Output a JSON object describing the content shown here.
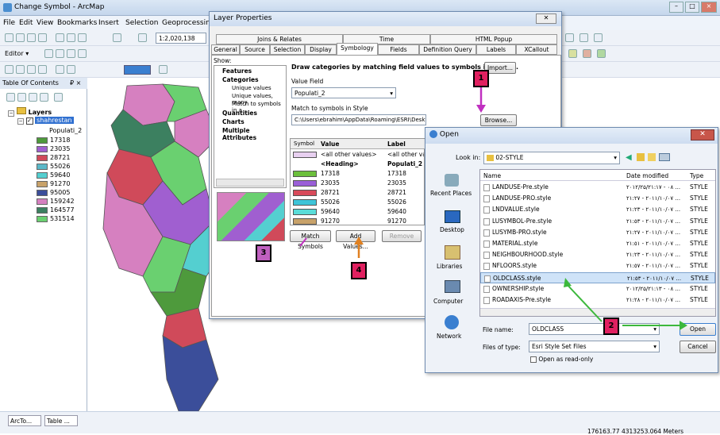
{
  "window": {
    "title": "Change Symbol - ArcMap",
    "controls": [
      "–",
      "□",
      "×"
    ]
  },
  "menu": [
    "File",
    "Edit",
    "View",
    "Bookmarks",
    "Insert",
    "Selection",
    "Geoprocessing"
  ],
  "toolbar": {
    "scale": "1:2,020,138",
    "editor": "Editor ▾"
  },
  "toc": {
    "title": "Table Of Contents",
    "pin": "₽ ×",
    "layers": "Layers",
    "layer": "shahrestan",
    "field": "Populati_2",
    "items": [
      {
        "v": "17318",
        "c": "#4e9a3c"
      },
      {
        "v": "23035",
        "c": "#a05fd0"
      },
      {
        "v": "28721",
        "c": "#d04a5a"
      },
      {
        "v": "55026",
        "c": "#5ab8c8"
      },
      {
        "v": "59640",
        "c": "#54cfd0"
      },
      {
        "v": "91270",
        "c": "#c8a26a"
      },
      {
        "v": "95005",
        "c": "#3b4e9a"
      },
      {
        "v": "159242",
        "c": "#d680c0"
      },
      {
        "v": "164577",
        "c": "#3c8060"
      },
      {
        "v": "531514",
        "c": "#6ad070"
      }
    ]
  },
  "status": {
    "tabs": [
      "ArcTo...",
      "Table ..."
    ],
    "coords": "176163.77  4313253.064 Meters"
  },
  "layerProps": {
    "title": "Layer Properties",
    "tabsTop": [
      "Joins & Relates",
      "Time",
      "HTML Popup"
    ],
    "tabs": [
      "General",
      "Source",
      "Selection",
      "Display",
      "Symbology",
      "Fields",
      "Definition Query",
      "Labels",
      "XCallout"
    ],
    "show": "Show:",
    "tree": [
      "Features",
      "Categories",
      "Unique values",
      "Unique values, many",
      "Match to symbols in a",
      "Quantities",
      "Charts",
      "Multiple Attributes"
    ],
    "heading": "Draw categories by matching field values to symbols in a style.",
    "import": "Import...",
    "valueField": "Value Field",
    "valueFieldVal": "Populati_2",
    "matchLabel": "Match to symbols in Style",
    "stylePath": "C:\\Users\\ebrahim\\AppData\\Roaming\\ESRI\\Desktop10.1",
    "browse": "Browse...",
    "cols": [
      "Symbol",
      "Value",
      "Label"
    ],
    "rows": [
      [
        "<all other values>",
        "<all other valu"
      ],
      [
        "<Heading>",
        "Populati_2"
      ],
      [
        "17318",
        "17318"
      ],
      [
        "23035",
        "23035"
      ],
      [
        "28721",
        "28721"
      ],
      [
        "55026",
        "55026"
      ],
      [
        "59640",
        "59640"
      ],
      [
        "91270",
        "91270"
      ]
    ],
    "rowColors": [
      "#e8d0f0",
      "",
      "#6cbf3c",
      "#9a5fd8",
      "#d84a5a",
      "#3ec4d8",
      "#5adcd8",
      "#c8a26a"
    ],
    "buttons": [
      "Match Symbols",
      "Add Values...",
      "Remove"
    ]
  },
  "open": {
    "title": "Open",
    "lookInLabel": "Look in:",
    "lookIn": "02-STYLE",
    "places": [
      "Recent Places",
      "Desktop",
      "Libraries",
      "Computer",
      "Network"
    ],
    "colHeaders": [
      "Name",
      "Date modified",
      "Type"
    ],
    "files": [
      [
        "LANDUSE-Pre.style",
        "٢٠١٢/٢۵/٠٨ - ٢١:١٧ ...",
        "STYLE"
      ],
      [
        "LANDUSE-PRO.style",
        "٢٠١١/١٠/٠٧ - ٢١:٢٧ ...",
        "STYLE"
      ],
      [
        "LNDVALUE.style",
        "٢٠١١/١٠/٠٧ - ٢١:٢٣ ...",
        "STYLE"
      ],
      [
        "LUSYMBOL-Pre.style",
        "٢٠١١/١٠/٠٧ - ٢١:٥٣ ...",
        "STYLE"
      ],
      [
        "LUSYMB-PRO.style",
        "٢٠١١/١٠/٠٧ - ٢١:٢٧ ...",
        "STYLE"
      ],
      [
        "MATERIAL.style",
        "٢٠١١/١٠/٠٧ - ٢١:٥١ ...",
        "STYLE"
      ],
      [
        "NEIGHBOURHOOD.style",
        "٢٠١١/١٠/٠٧ - ٢١:٢٣ ...",
        "STYLE"
      ],
      [
        "NFLOORS.style",
        "٢٠١١/١٠/٠٧ - ٢١:٥٧ ...",
        "STYLE"
      ],
      [
        "OLDCLASS.style",
        "٢٠١١/١٠/٠٧ - ٢١:٥٣ ...",
        "STYLE"
      ],
      [
        "OWNERSHIP.style",
        "٢٠١٢/٢۵/٠٨ - ٢١:١٣ ...",
        "STYLE"
      ],
      [
        "ROADAXIS-Pre.style",
        "٢٠١١/١٠/٠٧ - ٢١:٢٨ ...",
        "STYLE"
      ]
    ],
    "fileNameLabel": "File name:",
    "fileName": "OLDCLASS",
    "typeLabel": "Files of type:",
    "fileType": "Esri Style Set Files",
    "readonly": "Open as read-only",
    "openBtn": "Open",
    "cancelBtn": "Cancel"
  },
  "callouts": [
    "1",
    "2",
    "3",
    "4"
  ]
}
